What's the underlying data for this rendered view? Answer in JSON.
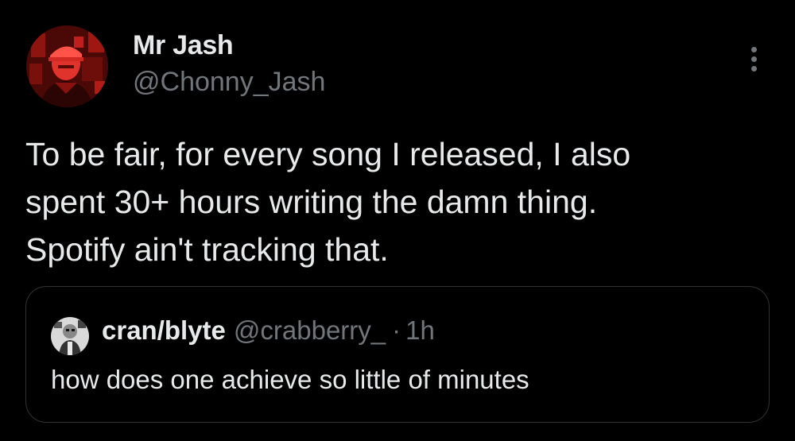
{
  "tweet": {
    "author": {
      "display_name": "Mr Jash",
      "handle": "@Chonny_Jash",
      "avatar_icon": "profile-photo-red-tint"
    },
    "more_icon": "more-vertical-icon",
    "text_lines": [
      "To be fair, for every song I released, I also",
      "spent 30+ hours writing the damn thing.",
      "Spotify ain't tracking that."
    ],
    "quote": {
      "display_name": "cran/blyte",
      "handle": "@crabberry_",
      "separator": "·",
      "time": "1h",
      "text": "how does one achieve so little of minutes",
      "avatar_icon": "profile-photo-grayscale"
    }
  },
  "colors": {
    "background": "#000000",
    "primary_text": "#e7e9ea",
    "secondary_text": "#71767b",
    "border": "#2f3336",
    "avatar_tint": "#c0201c"
  }
}
